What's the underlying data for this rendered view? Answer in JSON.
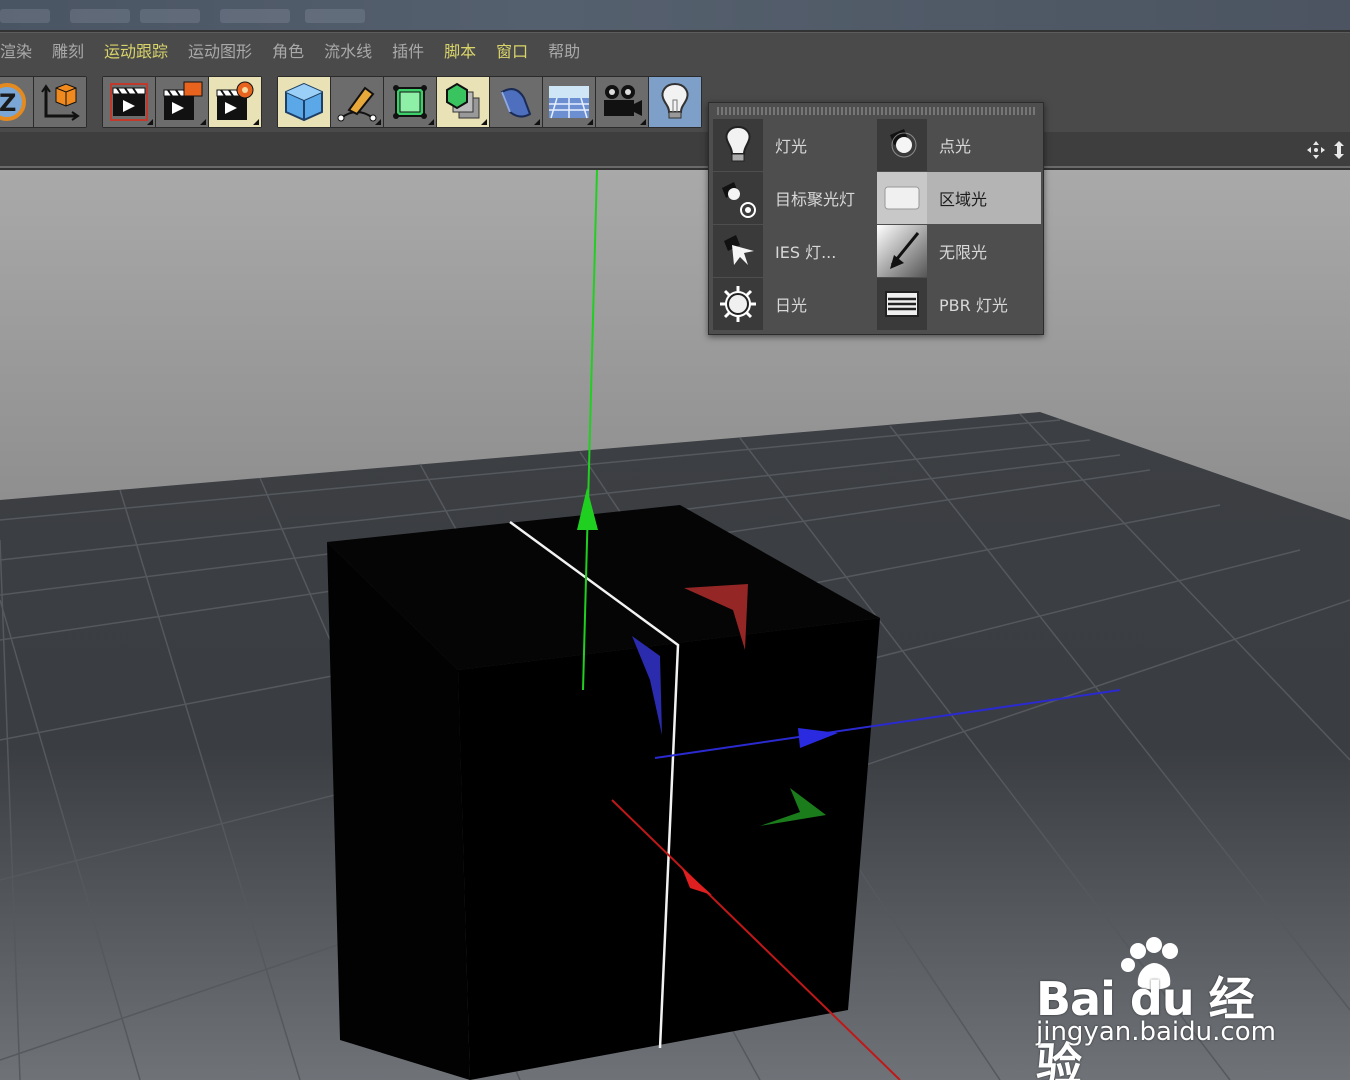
{
  "menu": {
    "items": [
      {
        "label": "渲染",
        "style": "dim"
      },
      {
        "label": "雕刻",
        "style": "dim"
      },
      {
        "label": "运动跟踪",
        "style": "hl"
      },
      {
        "label": "运动图形",
        "style": "dim"
      },
      {
        "label": "角色",
        "style": "dim"
      },
      {
        "label": "流水线",
        "style": "dim"
      },
      {
        "label": "插件",
        "style": "dim"
      },
      {
        "label": "脚本",
        "style": "hl"
      },
      {
        "label": "窗口",
        "style": "hl"
      },
      {
        "label": "帮助",
        "style": "dim"
      }
    ]
  },
  "toolbar": {
    "icons": [
      "z-axis-icon",
      "coordinate-system-icon",
      "render-view-icon",
      "render-active-icon",
      "render-settings-icon",
      "cube-icon",
      "pen-icon",
      "subdivision-icon",
      "array-icon",
      "deformer-icon",
      "floor-icon",
      "camera-icon",
      "light-icon"
    ]
  },
  "light_popup": {
    "items": [
      {
        "label": "灯光",
        "icon": "bulb-icon"
      },
      {
        "label": "点光",
        "icon": "spot-light-icon"
      },
      {
        "label": "目标聚光灯",
        "icon": "target-spot-icon"
      },
      {
        "label": "区域光",
        "icon": "area-light-icon",
        "highlighted": true
      },
      {
        "label": "IES 灯...",
        "icon": "ies-light-icon"
      },
      {
        "label": "无限光",
        "icon": "infinite-light-icon"
      },
      {
        "label": "日光",
        "icon": "sun-icon"
      },
      {
        "label": "PBR 灯光",
        "icon": "pbr-light-icon"
      }
    ]
  },
  "watermark": {
    "logo": "Bai du 经验",
    "url": "jingyan.baidu.com"
  },
  "colors": {
    "menu_highlight": "#d9d46a",
    "axis_x": "#e02020",
    "axis_y": "#20d020",
    "axis_z": "#2020e0"
  }
}
